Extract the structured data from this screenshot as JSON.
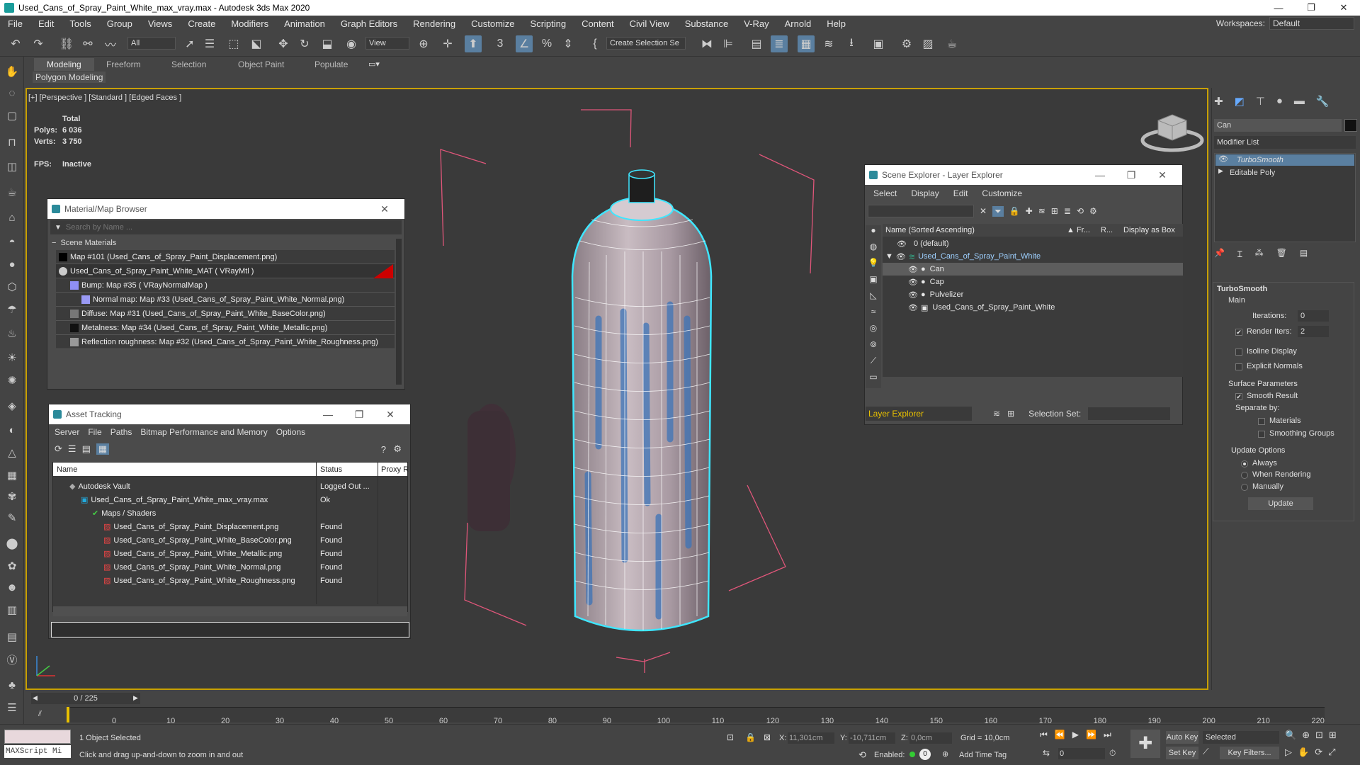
{
  "window": {
    "title": "Used_Cans_of_Spray_Paint_White_max_vray.max - Autodesk 3ds Max 2020",
    "controls": [
      "—",
      "❐",
      "✕"
    ]
  },
  "menu": [
    "File",
    "Edit",
    "Tools",
    "Group",
    "Views",
    "Create",
    "Modifiers",
    "Animation",
    "Graph Editors",
    "Rendering",
    "Customize",
    "Scripting",
    "Content",
    "Civil View",
    "Substance",
    "V-Ray",
    "Arnold",
    "Help"
  ],
  "workspace": {
    "label": "Workspaces:",
    "value": "Default"
  },
  "toolbar": {
    "selection_filter": "All",
    "ref_coord": "View",
    "named_selection": "Create Selection Se"
  },
  "ribbon": {
    "tabs": [
      "Modeling",
      "Freeform",
      "Selection",
      "Object Paint",
      "Populate"
    ],
    "sub": "Polygon Modeling"
  },
  "viewport": {
    "label": "[+] [Perspective ] [Standard ] [Edged Faces ]",
    "stats": {
      "total": "Total",
      "polys_label": "Polys:",
      "polys": "6 036",
      "verts_label": "Verts:",
      "verts": "3 750",
      "fps_label": "FPS:",
      "fps": "Inactive"
    }
  },
  "material_browser": {
    "title": "Material/Map Browser",
    "search_placeholder": "Search by Name ...",
    "group": "Scene Materials",
    "items": [
      "Map #101 (Used_Cans_of_Spray_Paint_Displacement.png)",
      "Used_Cans_of_Spray_Paint_White_MAT  ( VRayMtl )",
      "Bump: Map #35  ( VRayNormalMap )",
      "Normal map: Map #33 (Used_Cans_of_Spray_Paint_White_Normal.png)",
      "Diffuse: Map #31 (Used_Cans_of_Spray_Paint_White_BaseColor.png)",
      "Metalness: Map #34 (Used_Cans_of_Spray_Paint_White_Metallic.png)",
      "Reflection roughness: Map #32 (Used_Cans_of_Spray_Paint_White_Roughness.png)"
    ]
  },
  "asset_tracking": {
    "title": "Asset Tracking",
    "menu": [
      "Server",
      "File",
      "Paths",
      "Bitmap Performance and Memory",
      "Options"
    ],
    "columns": [
      "Name",
      "Status",
      "Proxy R"
    ],
    "rows": [
      {
        "name": "Autodesk Vault",
        "status": "Logged Out ..."
      },
      {
        "name": "Used_Cans_of_Spray_Paint_White_max_vray.max",
        "status": "Ok"
      },
      {
        "name": "Maps / Shaders",
        "status": ""
      },
      {
        "name": "Used_Cans_of_Spray_Paint_Displacement.png",
        "status": "Found"
      },
      {
        "name": "Used_Cans_of_Spray_Paint_White_BaseColor.png",
        "status": "Found"
      },
      {
        "name": "Used_Cans_of_Spray_Paint_White_Metallic.png",
        "status": "Found"
      },
      {
        "name": "Used_Cans_of_Spray_Paint_White_Normal.png",
        "status": "Found"
      },
      {
        "name": "Used_Cans_of_Spray_Paint_White_Roughness.png",
        "status": "Found"
      }
    ]
  },
  "scene_explorer": {
    "title": "Scene Explorer - Layer Explorer",
    "menu": [
      "Select",
      "Display",
      "Edit",
      "Customize"
    ],
    "columns": [
      "Name (Sorted Ascending)",
      "▲ Fr...",
      "R...",
      "Display as Box"
    ],
    "rows": [
      {
        "name": "0 (default)"
      },
      {
        "name": "Used_Cans_of_Spray_Paint_White"
      },
      {
        "name": "Can"
      },
      {
        "name": "Cap"
      },
      {
        "name": "Pulvelizer"
      },
      {
        "name": "Used_Cans_of_Spray_Paint_White"
      }
    ],
    "footer_explorer": "Layer Explorer",
    "selection_set_label": "Selection Set:"
  },
  "command_panel": {
    "object_name": "Can",
    "modifier_list": "Modifier List",
    "stack": [
      "TurboSmooth",
      "Editable Poly"
    ],
    "rollout": "TurboSmooth",
    "main": "Main",
    "iterations_label": "Iterations:",
    "iterations": "0",
    "render_iters_label": "Render Iters:",
    "render_iters": "2",
    "isoline": "Isoline Display",
    "explicit": "Explicit Normals",
    "surface": "Surface Parameters",
    "smooth_result": "Smooth Result",
    "separate_by": "Separate by:",
    "materials": "Materials",
    "smoothing_groups": "Smoothing Groups",
    "update_options": "Update Options",
    "always": "Always",
    "when_rendering": "When Rendering",
    "manually": "Manually",
    "update_btn": "Update"
  },
  "timeline": {
    "frame": "0 / 225",
    "ticks": [
      "0",
      "10",
      "20",
      "30",
      "40",
      "50",
      "60",
      "70",
      "80",
      "90",
      "100",
      "110",
      "120",
      "130",
      "140",
      "150",
      "160",
      "170",
      "180",
      "190",
      "200",
      "210",
      "220"
    ]
  },
  "status": {
    "maxscript": "MAXScript Mi",
    "selected": "1 Object Selected",
    "prompt": "Click and drag up-and-down to zoom in and out",
    "x_label": "X:",
    "x": "11,301cm",
    "y_label": "Y:",
    "y": "-10,711cm",
    "z_label": "Z:",
    "z": "0,0cm",
    "grid": "Grid = 10,0cm",
    "enabled": "Enabled:",
    "add_time_tag": "Add Time Tag",
    "auto_key": "Auto Key",
    "set_key": "Set Key",
    "key_mode": "Selected",
    "key_filters": "Key Filters...",
    "frame_field": "0"
  },
  "colors": {
    "accent": "#c8a000",
    "selection": "#5a7fa0",
    "cyan": "#00e5ff",
    "bbox": "#e0567a"
  }
}
